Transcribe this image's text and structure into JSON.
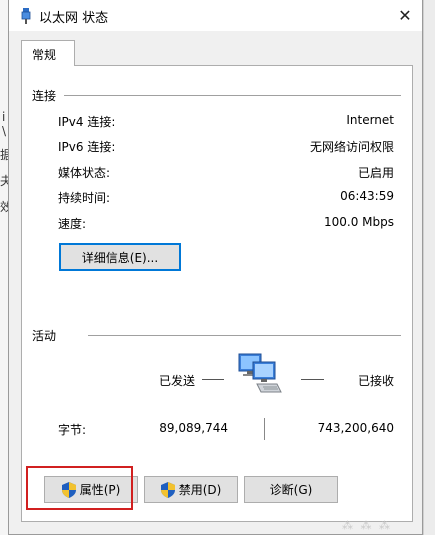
{
  "window": {
    "title": "以太网 状态",
    "close_glyph": "✕"
  },
  "tab": {
    "label": "常规"
  },
  "connection": {
    "section_title": "连接",
    "rows": [
      {
        "label": "IPv4 连接:",
        "value": "Internet"
      },
      {
        "label": "IPv6 连接:",
        "value": "无网络访问权限"
      },
      {
        "label": "媒体状态:",
        "value": "已启用"
      },
      {
        "label": "持续时间:",
        "value": "06:43:59"
      },
      {
        "label": "速度:",
        "value": "100.0 Mbps"
      }
    ],
    "details_button": "详细信息(E)..."
  },
  "activity": {
    "section_title": "活动",
    "sent_label": "已发送",
    "received_label": "已接收",
    "bytes_label": "字节:",
    "bytes_sent": "89,089,744",
    "bytes_received": "743,200,640"
  },
  "buttons": {
    "properties": "属性(P)",
    "disable": "禁用(D)",
    "diagnose": "诊断(G)"
  },
  "background_fragments": [
    "i",
    "\\",
    "据",
    "夬",
    "效"
  ],
  "icons": {
    "title": "network-adapter-icon",
    "activity": "network-computers-icon",
    "shield": "uac-shield-icon"
  },
  "colors": {
    "highlight_box": "#d12020",
    "focus": "#0078d7"
  }
}
